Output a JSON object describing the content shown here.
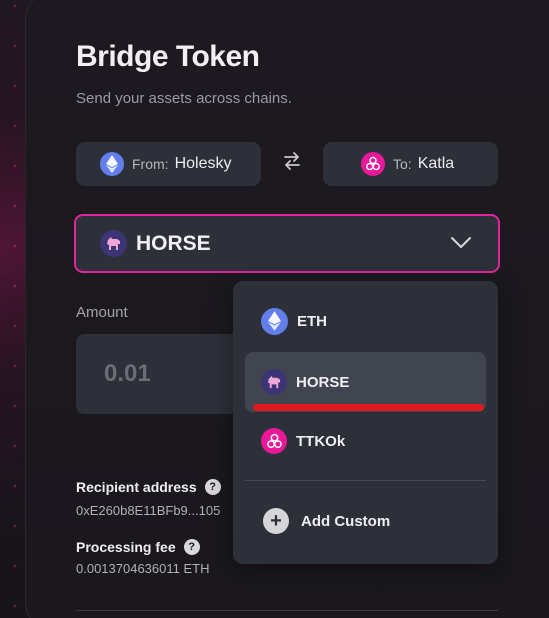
{
  "page": {
    "title": "Bridge Token",
    "subtitle": "Send your assets across chains."
  },
  "chains": {
    "from": {
      "label": "From:",
      "value": "Holesky",
      "icon": "ethereum-icon"
    },
    "to": {
      "label": "To:",
      "value": "Katla",
      "icon": "taiko-icon"
    },
    "swap_icon": "swap-arrows-icon"
  },
  "token_select": {
    "selected": "HORSE",
    "icon": "horse-icon",
    "chevron": "chevron-down-icon"
  },
  "amount": {
    "label": "Amount",
    "placeholder": "0.01"
  },
  "recipient": {
    "label": "Recipient address",
    "value": "0xE260b8E11BFb9...105"
  },
  "fee": {
    "label": "Processing fee",
    "value": "0.0013704636011 ETH"
  },
  "dropdown": {
    "items": [
      {
        "label": "ETH",
        "icon": "ethereum-icon"
      },
      {
        "label": "HORSE",
        "icon": "horse-icon",
        "active": true
      },
      {
        "label": "TTKOk",
        "icon": "taiko-icon"
      }
    ],
    "add_custom": "Add Custom"
  },
  "colors": {
    "accent": "#e0269a",
    "panel": "#2d3039",
    "underline": "#e0191f",
    "eth": "#627eea",
    "taiko": "#e81899",
    "horse_bg": "#3b3576"
  }
}
